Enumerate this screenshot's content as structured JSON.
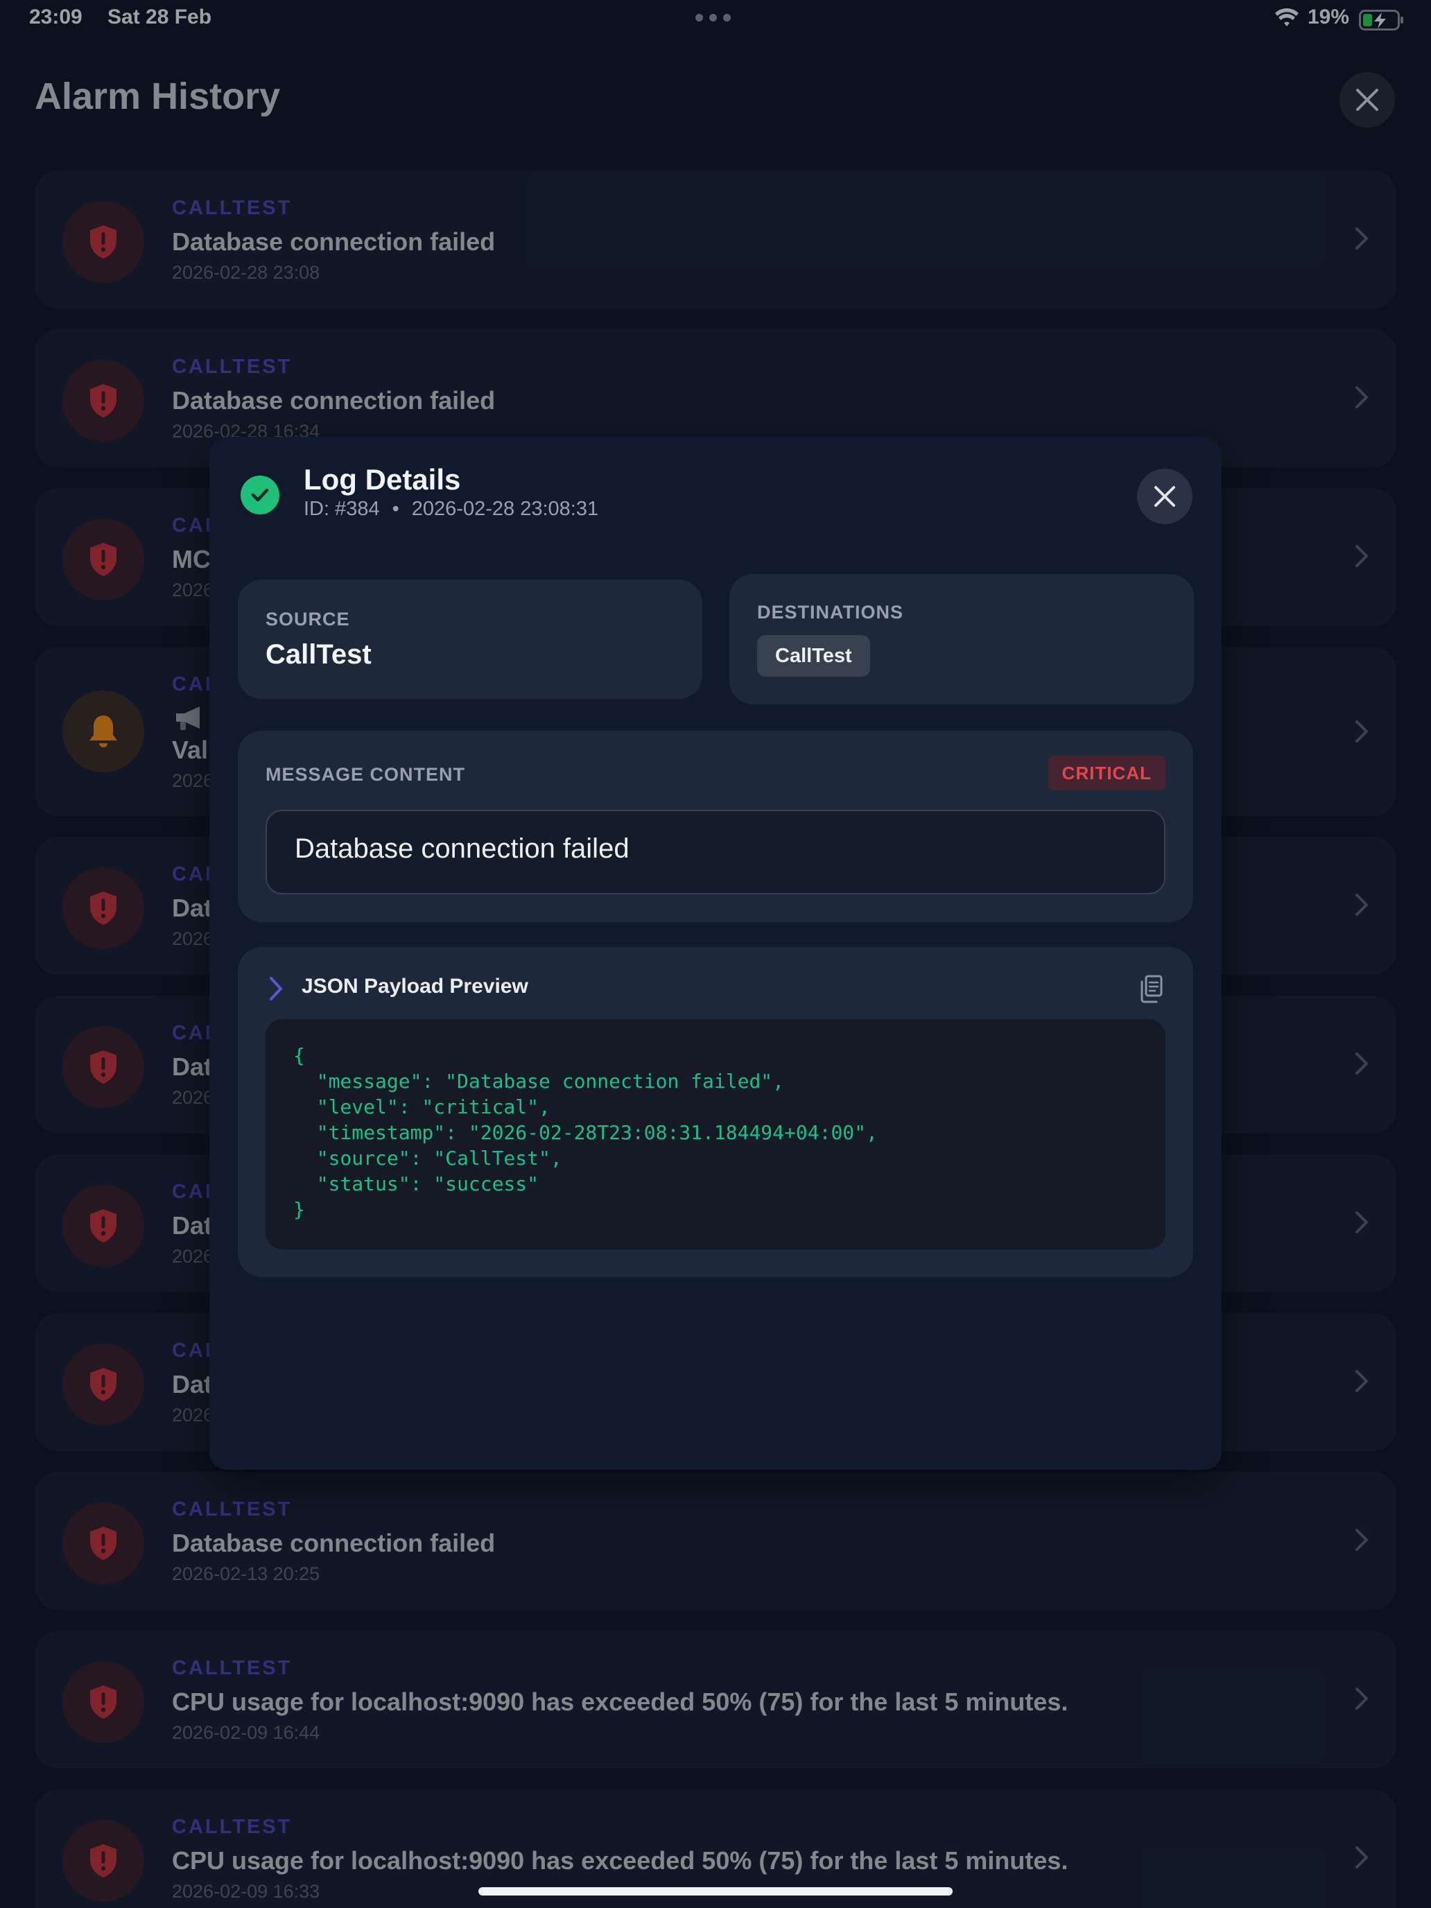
{
  "status_bar": {
    "time": "23:09",
    "date": "Sat 28 Feb",
    "battery": "19%"
  },
  "header": {
    "title": "Alarm History"
  },
  "alarms": [
    {
      "source": "CALLTEST",
      "title": "Database connection failed",
      "time": "2026-02-28 23:08",
      "icon": "shield-alert-icon"
    },
    {
      "source": "CALLTEST",
      "title": "Database connection failed",
      "time": "2026-02-28 16:34",
      "icon": "shield-alert-icon"
    },
    {
      "source": "CAL",
      "title": "MC",
      "time": "2026",
      "icon": "shield-alert-icon"
    },
    {
      "source": "CAL",
      "title": "Val",
      "time": "2026",
      "icon": "bell-icon"
    },
    {
      "source": "CAL",
      "title": "Dat",
      "time": "2026",
      "icon": "shield-alert-icon"
    },
    {
      "source": "CAL",
      "title": "Dat",
      "time": "2026",
      "icon": "shield-alert-icon"
    },
    {
      "source": "CAL",
      "title": "Dat",
      "time": "2026",
      "icon": "shield-alert-icon"
    },
    {
      "source": "CAL",
      "title": "Dat",
      "time": "2026",
      "icon": "shield-alert-icon"
    },
    {
      "source": "CALLTEST",
      "title": "Database connection failed",
      "time": "2026-02-13 20:25",
      "icon": "shield-alert-icon"
    },
    {
      "source": "CALLTEST",
      "title": "CPU usage for localhost:9090 has exceeded 50% (75) for the last 5 minutes.",
      "time": "2026-02-09 16:44",
      "icon": "shield-alert-icon"
    },
    {
      "source": "CALLTEST",
      "title": "CPU usage for localhost:9090 has exceeded 50% (75) for the last 5 minutes.",
      "time": "2026-02-09 16:33",
      "icon": "shield-alert-icon"
    }
  ],
  "modal": {
    "title": "Log Details",
    "id": "ID: #384",
    "separator": "•",
    "timestamp": "2026-02-28 23:08:31",
    "source_label": "SOURCE",
    "source_value": "CallTest",
    "destinations_label": "DESTINATIONS",
    "destinations": [
      "CallTest"
    ],
    "message_label": "MESSAGE CONTENT",
    "level_badge": "CRITICAL",
    "message": "Database connection failed",
    "json_title": "JSON Payload Preview",
    "json_preview": "{\n  \"message\": \"Database connection failed\",\n  \"level\": \"critical\",\n  \"timestamp\": \"2026-02-28T23:08:31.184494+04:00\",\n  \"source\": \"CallTest\",\n  \"status\": \"success\"\n}"
  },
  "colors": {
    "background": "#0f1626",
    "accent": "#4b45b3",
    "critical": "#e2474d",
    "success": "#1fbf7a",
    "warning": "#f08a12"
  }
}
